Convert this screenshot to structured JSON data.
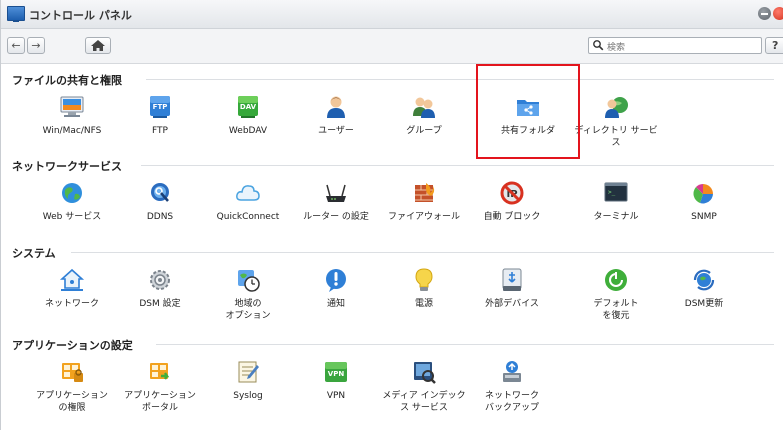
{
  "window": {
    "title": "コントロール パネル"
  },
  "toolbar": {
    "search_placeholder": "検索",
    "help_label": "?"
  },
  "sections": [
    {
      "title": "ファイルの共有と権限",
      "items": [
        {
          "label": "Win/Mac/NFS",
          "icon": "win-mac-nfs-icon"
        },
        {
          "label": "FTP",
          "icon": "ftp-icon",
          "badge": "FTP"
        },
        {
          "label": "WebDAV",
          "icon": "webdav-icon",
          "badge": "DAV"
        },
        {
          "label": "ユーザー",
          "icon": "user-icon"
        },
        {
          "label": "グループ",
          "icon": "group-icon"
        },
        {
          "label": "共有フォルダ",
          "icon": "shared-folder-icon"
        },
        {
          "label": "ディレクトリ サービス",
          "icon": "directory-service-icon"
        }
      ]
    },
    {
      "title": "ネットワークサービス",
      "items": [
        {
          "label": "Web サービス",
          "icon": "web-service-icon"
        },
        {
          "label": "DDNS",
          "icon": "ddns-icon"
        },
        {
          "label": "QuickConnect",
          "icon": "quickconnect-icon"
        },
        {
          "label": "ルーター の設定",
          "icon": "router-icon"
        },
        {
          "label": "ファイアウォール",
          "icon": "firewall-icon"
        },
        {
          "label": "自動 ブロック",
          "icon": "auto-block-icon"
        },
        {
          "label": "ターミナル",
          "icon": "terminal-icon"
        },
        {
          "label": "SNMP",
          "icon": "snmp-icon"
        }
      ]
    },
    {
      "title": "システム",
      "items": [
        {
          "label": "ネットワーク",
          "icon": "network-icon"
        },
        {
          "label": "DSM 設定",
          "icon": "dsm-settings-icon"
        },
        {
          "label": "地域の\nオプション",
          "icon": "regional-options-icon"
        },
        {
          "label": "通知",
          "icon": "notification-icon"
        },
        {
          "label": "電源",
          "icon": "power-icon"
        },
        {
          "label": "外部デバイス",
          "icon": "external-device-icon"
        },
        {
          "label": "デフォルト\nを復元",
          "icon": "restore-default-icon"
        },
        {
          "label": "DSM更新",
          "icon": "dsm-update-icon"
        }
      ]
    },
    {
      "title": "アプリケーションの設定",
      "items": [
        {
          "label": "アプリケーション\nの権限",
          "icon": "app-privileges-icon"
        },
        {
          "label": "アプリケーション\nポータル",
          "icon": "app-portal-icon"
        },
        {
          "label": "Syslog",
          "icon": "syslog-icon"
        },
        {
          "label": "VPN",
          "icon": "vpn-icon",
          "badge": "VPN"
        },
        {
          "label": "メディア インデック\nス サービス",
          "icon": "media-index-icon"
        },
        {
          "label": "ネットワーク\nバックアップ",
          "icon": "network-backup-icon"
        }
      ]
    }
  ],
  "colors": {
    "highlight": "#e3141d",
    "accent_blue": "#2f7fd6"
  }
}
